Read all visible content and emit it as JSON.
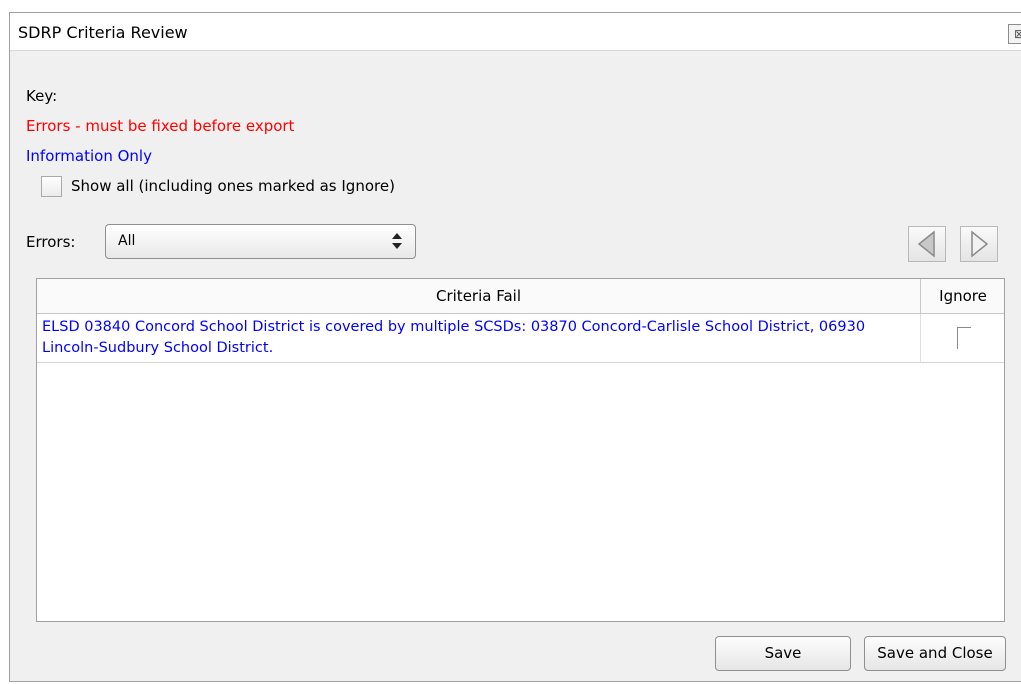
{
  "window": {
    "title": "SDRP Criteria Review",
    "close_symbol": "⊠"
  },
  "key": {
    "label": "Key:",
    "error_legend": "Errors - must be fixed before export",
    "info_legend": "Information Only",
    "error_color": "#ff0000",
    "info_color": "#0000ff"
  },
  "show_all": {
    "label": "Show all (including ones marked as Ignore)",
    "checked": false
  },
  "filter": {
    "label": "Errors:",
    "selected": "All"
  },
  "nav": {
    "prev_icon": "triangle-left-icon",
    "next_icon": "triangle-right-icon"
  },
  "table": {
    "columns": [
      "Criteria Fail",
      "Ignore"
    ],
    "rows": [
      {
        "criteria": "ELSD 03840 Concord School District is covered by multiple SCSDs: 03870 Concord-Carlisle School District, 06930 Lincoln-Sudbury School District.",
        "ignore": false
      }
    ]
  },
  "buttons": {
    "save": "Save",
    "save_and_close": "Save and Close"
  }
}
